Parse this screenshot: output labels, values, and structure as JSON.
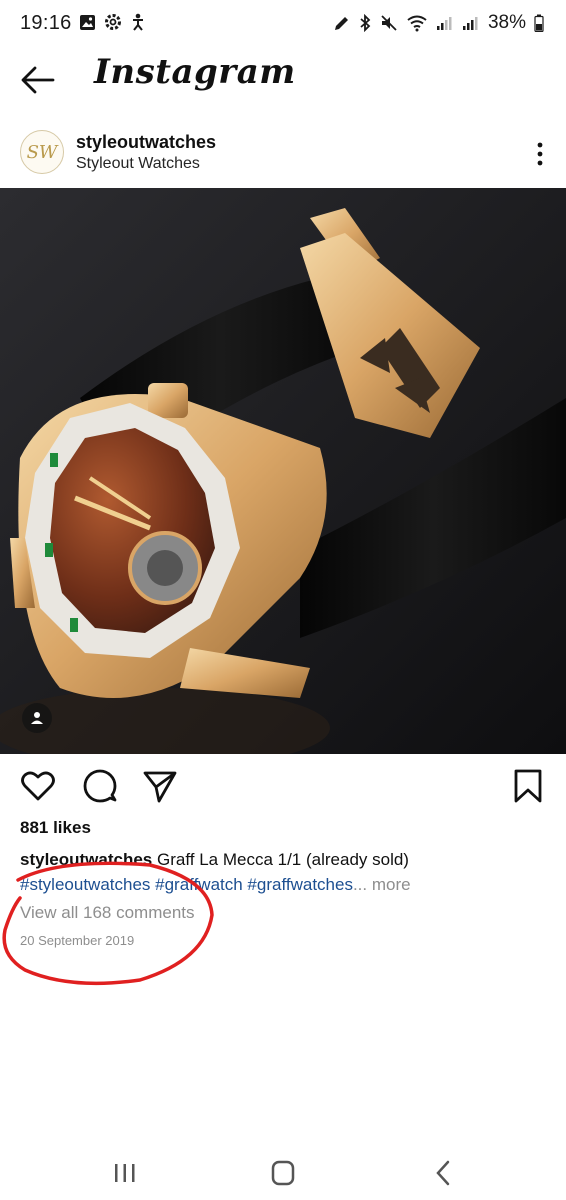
{
  "status_bar": {
    "time": "19:16",
    "battery": "38%"
  },
  "app_bar": {
    "title": "Instagram"
  },
  "post": {
    "avatar_initials": "SW",
    "username": "styleoutwatches",
    "subtitle": "Styleout Watches",
    "likes": "881 likes",
    "caption_user": "styleoutwatches",
    "caption_text": "Graff La Mecca 1/1 (already sold)",
    "caption_tags": "#styleoutwatches #graffwatch #graffwatches",
    "caption_ellipsis": "...",
    "caption_more": "more",
    "view_comments": "View all 168 comments",
    "date": "20 September 2019"
  },
  "icons": {
    "back": "back-arrow-icon",
    "more": "more-vertical-icon",
    "like": "heart-icon",
    "comment": "comment-icon",
    "share": "send-icon",
    "save": "bookmark-icon",
    "tag": "user-tag-icon"
  },
  "colors": {
    "hashtag": "#1d4f91",
    "muted": "#8e8e8e",
    "annotation": "#e02020"
  }
}
